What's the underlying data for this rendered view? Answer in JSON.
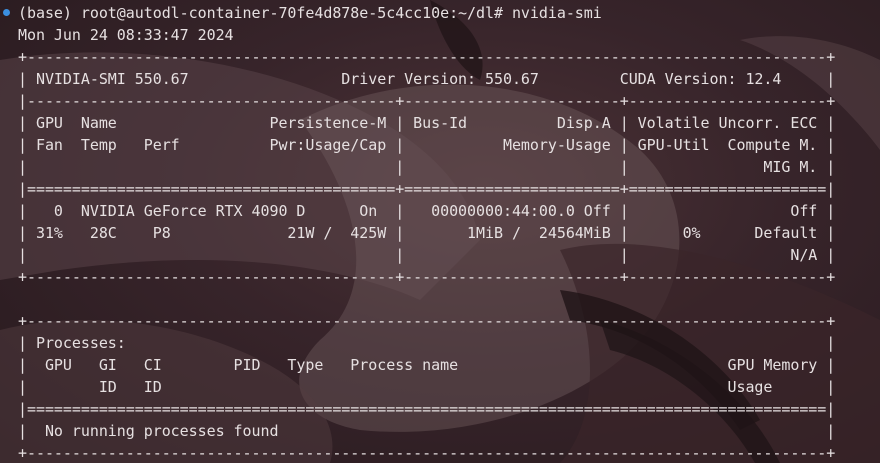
{
  "colors": {
    "background": "#2f1f23",
    "text": "#e6e0e1",
    "prompt_dot": "#3b8fe0"
  },
  "terminal": {
    "prompt": "(base) root@autodl-container-70fe4d878e-5c4cc10e:~/dl# nvidia-smi",
    "lines": [
      "Mon Jun 24 08:33:47 2024",
      "+-----------------------------------------------------------------------------------------+",
      "| NVIDIA-SMI 550.67                 Driver Version: 550.67         CUDA Version: 12.4     |",
      "|-----------------------------------------+------------------------+----------------------+",
      "| GPU  Name                 Persistence-M | Bus-Id          Disp.A | Volatile Uncorr. ECC |",
      "| Fan  Temp   Perf          Pwr:Usage/Cap |           Memory-Usage | GPU-Util  Compute M. |",
      "|                                         |                        |               MIG M. |",
      "|=========================================+========================+======================|",
      "|   0  NVIDIA GeForce RTX 4090 D      On  |   00000000:44:00.0 Off |                  Off |",
      "| 31%   28C    P8             21W /  425W |       1MiB /  24564MiB |      0%      Default |",
      "|                                         |                        |                  N/A |",
      "+-----------------------------------------+------------------------+----------------------+",
      "",
      "+-----------------------------------------------------------------------------------------+",
      "| Processes:                                                                              |",
      "|  GPU   GI   CI        PID   Type   Process name                              GPU Memory |",
      "|        ID   ID                                                               Usage      |",
      "|=========================================================================================|",
      "|  No running processes found                                                             |",
      "+-----------------------------------------------------------------------------------------+"
    ]
  }
}
